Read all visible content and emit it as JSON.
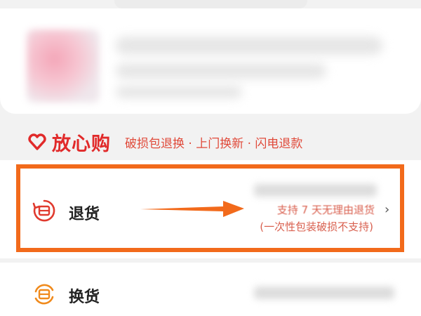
{
  "guarantee": {
    "brand": "放心购",
    "description": "破损包退换 · 上门换新 · 闪电退款"
  },
  "options": [
    {
      "label": "退货",
      "sub_line1": "支持 7 天无理由退货",
      "sub_line2": "(一次性包装破损不支持)",
      "chevron": "›",
      "icon": "return-icon",
      "icon_color": "#e03a2e"
    },
    {
      "label": "换货",
      "icon": "exchange-icon",
      "icon_color": "#f08a1c"
    }
  ],
  "colors": {
    "highlight": "#f26a1b",
    "brand_red": "#e12a2a",
    "hint": "#d9604f"
  }
}
